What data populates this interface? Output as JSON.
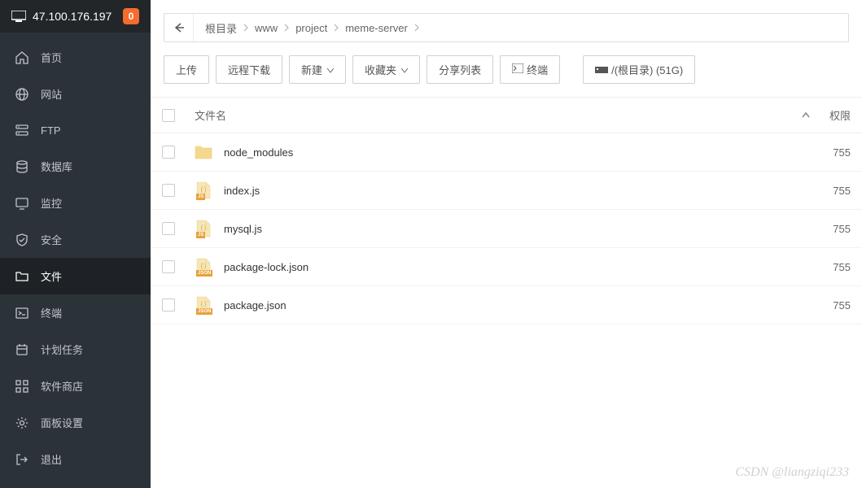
{
  "header": {
    "ip": "47.100.176.197",
    "badge": "0"
  },
  "sidebar": {
    "items": [
      {
        "id": "home",
        "label": "首页",
        "icon": "home"
      },
      {
        "id": "website",
        "label": "网站",
        "icon": "globe"
      },
      {
        "id": "ftp",
        "label": "FTP",
        "icon": "ftp"
      },
      {
        "id": "database",
        "label": "数据库",
        "icon": "database"
      },
      {
        "id": "monitor",
        "label": "监控",
        "icon": "monitor"
      },
      {
        "id": "security",
        "label": "安全",
        "icon": "shield"
      },
      {
        "id": "files",
        "label": "文件",
        "icon": "folder",
        "active": true
      },
      {
        "id": "terminal",
        "label": "终端",
        "icon": "terminal"
      },
      {
        "id": "cron",
        "label": "计划任务",
        "icon": "calendar"
      },
      {
        "id": "store",
        "label": "软件商店",
        "icon": "grid"
      },
      {
        "id": "settings",
        "label": "面板设置",
        "icon": "gear"
      },
      {
        "id": "logout",
        "label": "退出",
        "icon": "exit"
      }
    ]
  },
  "breadcrumb": {
    "segments": [
      "根目录",
      "www",
      "project",
      "meme-server"
    ]
  },
  "toolbar": {
    "upload": "上传",
    "remote_download": "远程下载",
    "new": "新建",
    "favorites": "收藏夹",
    "share_list": "分享列表",
    "terminal": "终端",
    "disk_info": "/(根目录) (51G)"
  },
  "table": {
    "headers": {
      "filename": "文件名",
      "perm": "权限"
    },
    "rows": [
      {
        "name": "node_modules",
        "type": "folder",
        "perm": "755"
      },
      {
        "name": "index.js",
        "type": "js",
        "perm": "755"
      },
      {
        "name": "mysql.js",
        "type": "js",
        "perm": "755"
      },
      {
        "name": "package-lock.json",
        "type": "json",
        "perm": "755"
      },
      {
        "name": "package.json",
        "type": "json",
        "perm": "755"
      }
    ]
  },
  "watermark": "CSDN @liangziqi233"
}
